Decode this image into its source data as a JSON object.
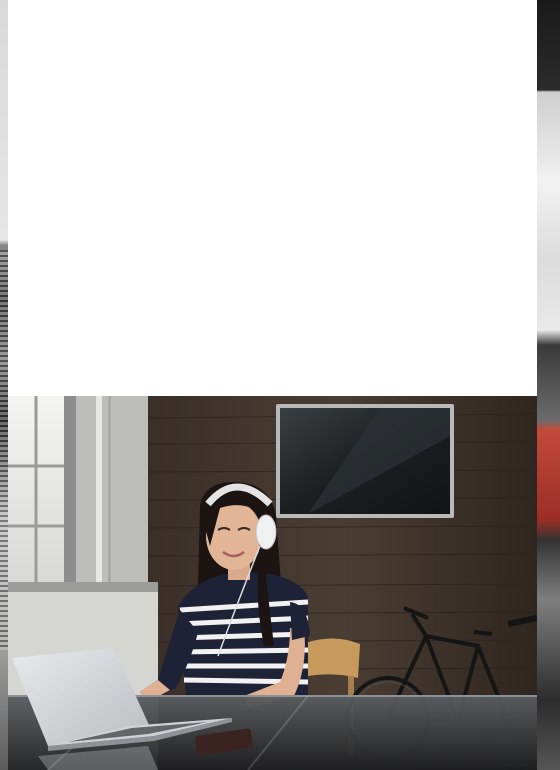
{
  "page": {
    "background_color": "#6e6e6e",
    "card_color": "#ffffff"
  },
  "photo": {
    "subject": "woman-with-headphones-using-laptop",
    "icon": "photo-image"
  }
}
